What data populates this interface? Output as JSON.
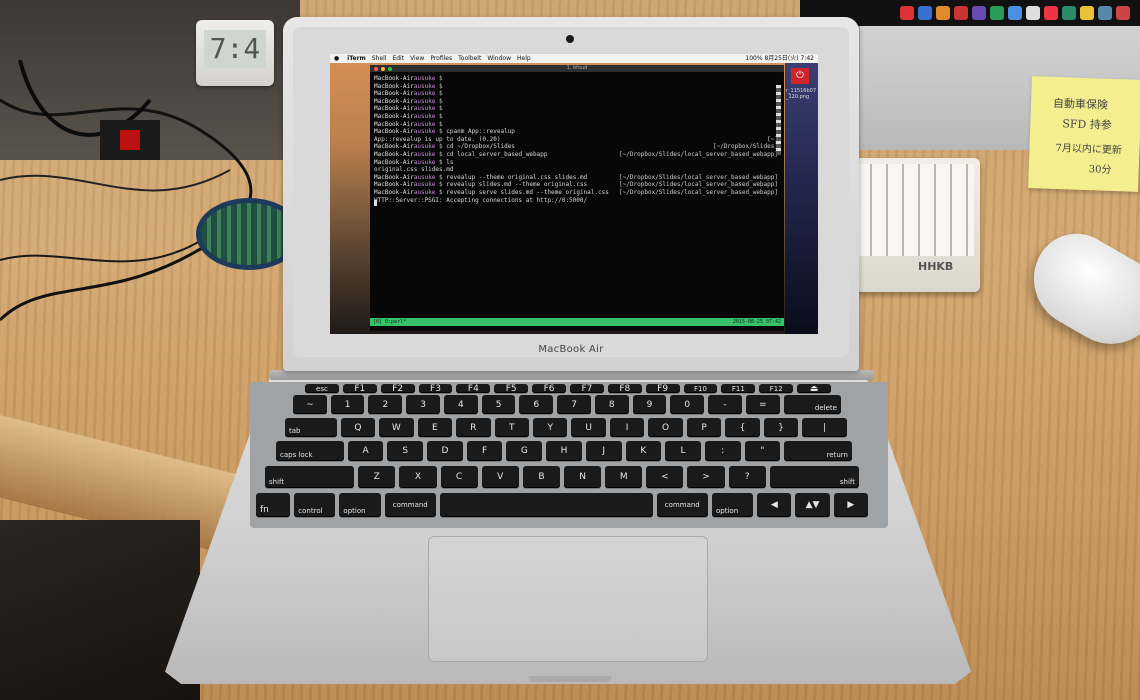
{
  "scene": {
    "laptop_label": "MacBook Air",
    "clock_time": "7:4",
    "keyboard_logo": "HHKB"
  },
  "sticky_note": {
    "lines": [
      "自動車保険",
      "SFD 持参",
      "7月以内に更新",
      "30分"
    ]
  },
  "screen": {
    "menubar": {
      "items": [
        "iTerm",
        "Shell",
        "Edit",
        "View",
        "Profiles",
        "Toolbelt",
        "Window",
        "Help"
      ],
      "status": "100%  8月25日(火) 7:42"
    },
    "desktop_file_label": "r_11516b07\n_120.png",
    "terminal": {
      "title": "1. bfoud",
      "lines": [
        {
          "host": "MacBook-Air",
          "user": "ausuke",
          "prompt": " $",
          "cmd": "",
          "right": ""
        },
        {
          "host": "MacBook-Air",
          "user": "ausuke",
          "prompt": " $",
          "cmd": "",
          "right": ""
        },
        {
          "host": "MacBook-Air",
          "user": "ausuke",
          "prompt": " $",
          "cmd": "",
          "right": ""
        },
        {
          "host": "MacBook-Air",
          "user": "ausuke",
          "prompt": " $",
          "cmd": "",
          "right": ""
        },
        {
          "host": "MacBook-Air",
          "user": "ausuke",
          "prompt": " $",
          "cmd": "",
          "right": ""
        },
        {
          "host": "MacBook-Air",
          "user": "ausuke",
          "prompt": " $",
          "cmd": "",
          "right": ""
        },
        {
          "host": "MacBook-Air",
          "user": "ausuke",
          "prompt": " $",
          "cmd": "",
          "right": ""
        },
        {
          "host": "MacBook-Air",
          "user": "ausuke",
          "prompt": " $",
          "cmd": " cpanm App::revealup",
          "right": ""
        },
        {
          "host": "",
          "user": "",
          "prompt": "",
          "cmd": "App::revealup is up to date. (0.20)",
          "right": "[~]"
        },
        {
          "host": "MacBook-Air",
          "user": "ausuke",
          "prompt": " $",
          "cmd": " cd ~/Dropbox/Slides",
          "right": "[~/Dropbox/Slides]"
        },
        {
          "host": "MacBook-Air",
          "user": "ausuke",
          "prompt": " $",
          "cmd": " cd local_server_based_webapp",
          "right": "[~/Dropbox/Slides/local_server_based_webapp]"
        },
        {
          "host": "MacBook-Air",
          "user": "ausuke",
          "prompt": " $",
          "cmd": " ls",
          "right": ""
        },
        {
          "host": "",
          "user": "",
          "prompt": "",
          "cmd": "original.css slides.md",
          "right": ""
        },
        {
          "host": "MacBook-Air",
          "user": "ausuke",
          "prompt": " $",
          "cmd": " revealup --theme original.css slides.md",
          "right": "[~/Dropbox/Slides/local_server_based_webapp]"
        },
        {
          "host": "MacBook-Air",
          "user": "ausuke",
          "prompt": " $",
          "cmd": " revealup slides.md --theme original.css",
          "right": "[~/Dropbox/Slides/local_server_based_webapp]"
        },
        {
          "host": "MacBook-Air",
          "user": "ausuke",
          "prompt": " $",
          "cmd": " revealup serve slides.md --theme original.css",
          "right": "[~/Dropbox/Slides/local_server_based_webapp]"
        },
        {
          "host": "",
          "user": "",
          "prompt": "",
          "cmd": "HTTP::Server::PSGI: Accepting connections at http://0:5000/",
          "right": ""
        }
      ],
      "status_left": "[0] 0:perl*",
      "status_right": "2015-08-25 07:42"
    }
  },
  "keyboard": {
    "rows": [
      [
        "esc",
        "F1",
        "F2",
        "F3",
        "F4",
        "F5",
        "F6",
        "F7",
        "F8",
        "F9",
        "F10",
        "F11",
        "F12",
        "⏏"
      ],
      [
        "~",
        "1",
        "2",
        "3",
        "4",
        "5",
        "6",
        "7",
        "8",
        "9",
        "0",
        "-",
        "=",
        "delete"
      ],
      [
        "tab",
        "Q",
        "W",
        "E",
        "R",
        "T",
        "Y",
        "U",
        "I",
        "O",
        "P",
        "{",
        "}",
        "|"
      ],
      [
        "caps lock",
        "A",
        "S",
        "D",
        "F",
        "G",
        "H",
        "J",
        "K",
        "L",
        ":",
        "\"",
        "return"
      ],
      [
        "shift",
        "Z",
        "X",
        "C",
        "V",
        "B",
        "N",
        "M",
        "<",
        ">",
        "?",
        "shift"
      ],
      [
        "fn",
        "control",
        "option",
        "command",
        "",
        "command",
        "option",
        "◀",
        "▲▼",
        "▶"
      ]
    ]
  },
  "colors": {
    "prompt_user": "#c78ed6",
    "tmux_status": "#37c26a",
    "desk": "#d3a872"
  }
}
